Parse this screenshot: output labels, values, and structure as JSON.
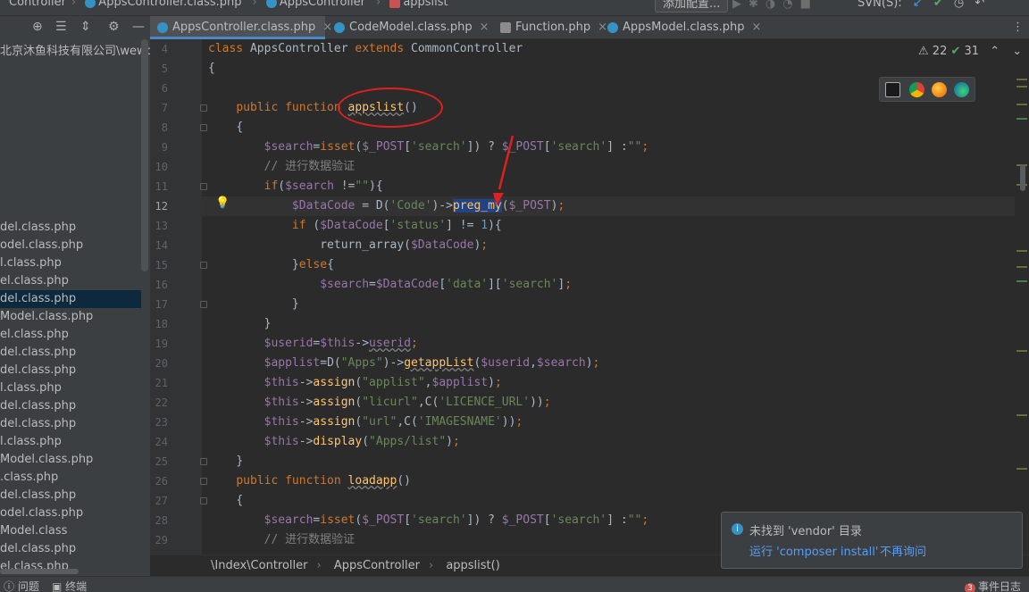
{
  "topbar": {
    "crumbs": [
      "Controller",
      "AppsController.class.php",
      "AppsController",
      "appslist"
    ],
    "add_config": "添加配置...",
    "svn_label": "SVN(S):"
  },
  "project": {
    "header": "北京沐鱼科技有限公司\\wework-",
    "files": [
      "del.class.php",
      "odel.class.php",
      "l.class.php",
      "el.class.php",
      "del.class.php",
      "Model.class.php",
      "el.class.php",
      "del.class.php",
      "del.class.php",
      "l.class.php",
      "del.class.php",
      "del.class.php",
      "l.class.php",
      "Model.class.php",
      ".class.php",
      "del.class.php",
      "odel.class.php",
      "Model.class",
      "del.class.php",
      "el.class.php"
    ],
    "selected_index": 4
  },
  "tabs": [
    {
      "label": "AppsController.class.php",
      "active": true,
      "icon": "class-icon"
    },
    {
      "label": "CodeModel.class.php",
      "active": false,
      "icon": "class-icon"
    },
    {
      "label": "Function.php",
      "active": false,
      "icon": "php-file-icon"
    },
    {
      "label": "AppsModel.class.php",
      "active": false,
      "icon": "class-icon"
    }
  ],
  "inspections": {
    "warnings": "22",
    "ok": "31"
  },
  "editor": {
    "line_numbers": [
      "4",
      "5",
      "6",
      "7",
      "8",
      "9",
      "10",
      "11",
      "12",
      "13",
      "14",
      "15",
      "16",
      "17",
      "18",
      "19",
      "20",
      "21",
      "22",
      "23",
      "24",
      "25",
      "26",
      "27",
      "28",
      "29"
    ],
    "current_line": "12"
  },
  "breadcrumb": [
    "\\Index\\Controller",
    "AppsController",
    "appslist()"
  ],
  "notification": {
    "title": "未找到 'vendor' 目录",
    "action_primary": "运行 'composer install'",
    "action_secondary": "不再询问"
  },
  "status": {
    "problems": "问题",
    "terminal": "终端",
    "event_log": "事件日志",
    "event_count": "3"
  }
}
